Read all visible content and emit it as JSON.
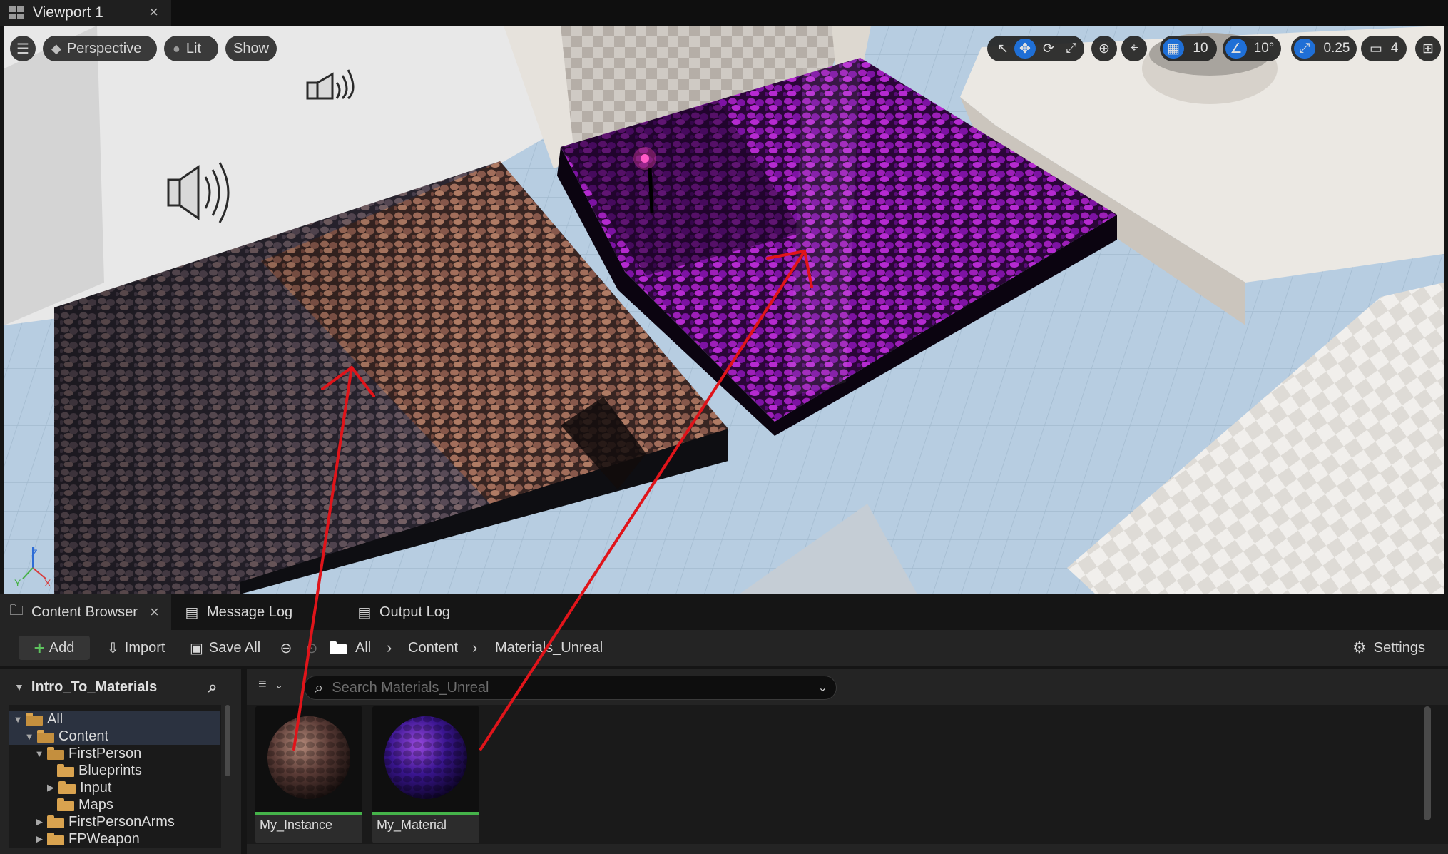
{
  "window": {
    "tab_title": "Viewport 1",
    "close_glyph": "×"
  },
  "viewport": {
    "view_mode": "Perspective",
    "lighting": "Lit",
    "show": "Show",
    "grid_snap_value": "10",
    "rotation_snap_value": "10°",
    "scale_snap_value": "0.25",
    "camera_speed_value": "4",
    "axis_labels": {
      "z": "Z",
      "x": "X",
      "y": "Y"
    }
  },
  "bottom_tabs": {
    "content_browser": "Content Browser",
    "message_log": "Message Log",
    "output_log": "Output Log",
    "close_glyph": "×"
  },
  "toolbar": {
    "add": "Add",
    "import": "Import",
    "save_all": "Save All",
    "breadcrumb": [
      "All",
      "Content",
      "Materials_Unreal"
    ],
    "settings": "Settings"
  },
  "sources": {
    "project": "Intro_To_Materials",
    "tree": [
      {
        "label": "All",
        "depth": 0,
        "expanded": true,
        "selected": true
      },
      {
        "label": "Content",
        "depth": 1,
        "expanded": true,
        "selected": true
      },
      {
        "label": "FirstPerson",
        "depth": 2,
        "expanded": true
      },
      {
        "label": "Blueprints",
        "depth": 3
      },
      {
        "label": "Input",
        "depth": 3,
        "collapsed": true
      },
      {
        "label": "Maps",
        "depth": 3
      },
      {
        "label": "FirstPersonArms",
        "depth": 2,
        "collapsed": true
      },
      {
        "label": "FPWeapon",
        "depth": 2,
        "collapsed": true
      }
    ]
  },
  "search": {
    "placeholder": "Search Materials_Unreal"
  },
  "assets": [
    {
      "name": "My_Instance"
    },
    {
      "name": "My_Material"
    }
  ],
  "colors": {
    "accent": "#1f6fd6",
    "asset_bar": "#45b34a",
    "annotation": "#e0141a",
    "folder": "#d9a34f"
  }
}
